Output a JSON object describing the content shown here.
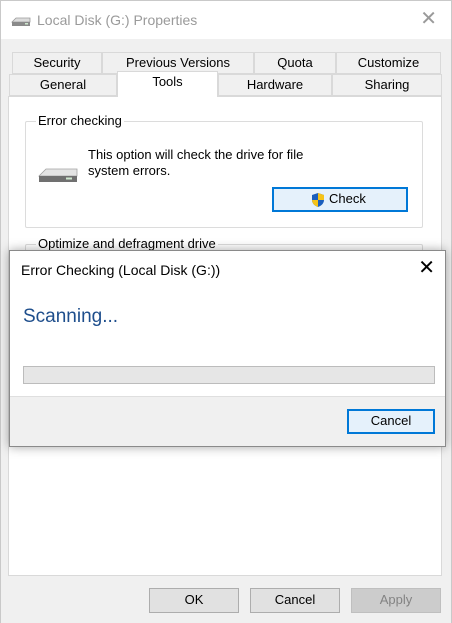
{
  "window": {
    "title": "Local Disk (G:) Properties",
    "close_glyph": "✕"
  },
  "tabs": {
    "row1": [
      {
        "label": "Security"
      },
      {
        "label": "Previous Versions"
      },
      {
        "label": "Quota"
      },
      {
        "label": "Customize"
      }
    ],
    "row2": [
      {
        "label": "General"
      },
      {
        "label": "Tools",
        "active": true
      },
      {
        "label": "Hardware"
      },
      {
        "label": "Sharing"
      }
    ]
  },
  "error_checking": {
    "group_label": "Error checking",
    "description_line1": "This option will check the drive for file",
    "description_line2": "system errors.",
    "check_label": "Check"
  },
  "optimize": {
    "group_label": "Optimize and defragment drive"
  },
  "dialog": {
    "title": "Error Checking (Local Disk (G:))",
    "close_glyph": "✕",
    "status": "Scanning...",
    "progress_percent": 0,
    "cancel_label": "Cancel"
  },
  "footer": {
    "ok_label": "OK",
    "cancel_label": "Cancel",
    "apply_label": "Apply"
  },
  "colors": {
    "status_text": "#1e4e8c",
    "focus_border": "#0078d7"
  },
  "icons": {
    "title": "drive-icon",
    "group": "drive-icon",
    "check_button": "uac-shield-icon"
  }
}
